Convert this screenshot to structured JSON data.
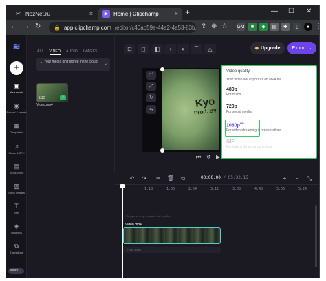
{
  "browser": {
    "tabs": [
      {
        "title": "NozNet.ru",
        "icon": "scissors-icon",
        "close": "×"
      },
      {
        "title": "Home | Clipchamp",
        "icon": "clipchamp-icon",
        "close": "×"
      }
    ],
    "new_tab": "+",
    "window_controls": {
      "minimize": "—",
      "maximize": "☐",
      "close": "✕"
    },
    "nav": {
      "back": "←",
      "forward": "→",
      "reload": "↻"
    },
    "url": {
      "host": "app.clipchamp.com",
      "path": "/editor/c40ad59e-44a2-4a53-83b..."
    },
    "extensions": [
      "GM"
    ]
  },
  "sidebar": {
    "items": [
      {
        "label": "Your media",
        "icon": "film-icon",
        "glyph": "▣"
      },
      {
        "label": "Record & create",
        "icon": "camera-icon",
        "glyph": "◉"
      },
      {
        "label": "Templates",
        "icon": "grid-icon",
        "glyph": "▦"
      },
      {
        "label": "Music & SFX",
        "icon": "music-icon",
        "glyph": "♫"
      },
      {
        "label": "Stock video",
        "icon": "video-icon",
        "glyph": "▤"
      },
      {
        "label": "Stock images",
        "icon": "image-icon",
        "glyph": "▨"
      },
      {
        "label": "Text",
        "icon": "text-icon",
        "glyph": "T"
      },
      {
        "label": "Graphics",
        "icon": "shapes-icon",
        "glyph": "◈"
      },
      {
        "label": "Transitions",
        "icon": "transition-icon",
        "glyph": "⧉"
      }
    ],
    "more": "More ⌄"
  },
  "media": {
    "tabs": [
      "ALL",
      "VIDEO",
      "AUDIO",
      "IMAGES"
    ],
    "active_tab": "VIDEO",
    "notice": "Your media isn't stored in the cloud",
    "thumb": {
      "duration": "5:32",
      "name": "Video.mp4"
    }
  },
  "toolbar": {
    "upgrade": "Upgrade",
    "export": "Export"
  },
  "export_menu": {
    "title": "Video quality",
    "note": "Your video will export as an MP4 file",
    "options": [
      {
        "name": "480p",
        "sub": "For drafts"
      },
      {
        "name": "720p",
        "sub": "For social media"
      },
      {
        "name": "1080p",
        "badge": "HD",
        "sub": "For video streaming & presentations"
      },
      {
        "name": "GIF",
        "sub": "For videos 15 seconds or less"
      }
    ],
    "selected": "1080p"
  },
  "preview": {
    "video_text_1": "Kyo",
    "video_text_2": "Prod. By"
  },
  "help": "?",
  "timeline": {
    "current": "00:00.00",
    "separator": "/",
    "total": "05:32.15",
    "ticks": [
      "0",
      "1:18",
      "1:36",
      "2:54",
      "3:12",
      "3:30",
      "4:48",
      "5:06",
      "5:24"
    ],
    "clip_label": "Video.mp4",
    "track_hint": "+ Drag and drop media to the timeline",
    "audio_hint": "+ Add audio"
  }
}
